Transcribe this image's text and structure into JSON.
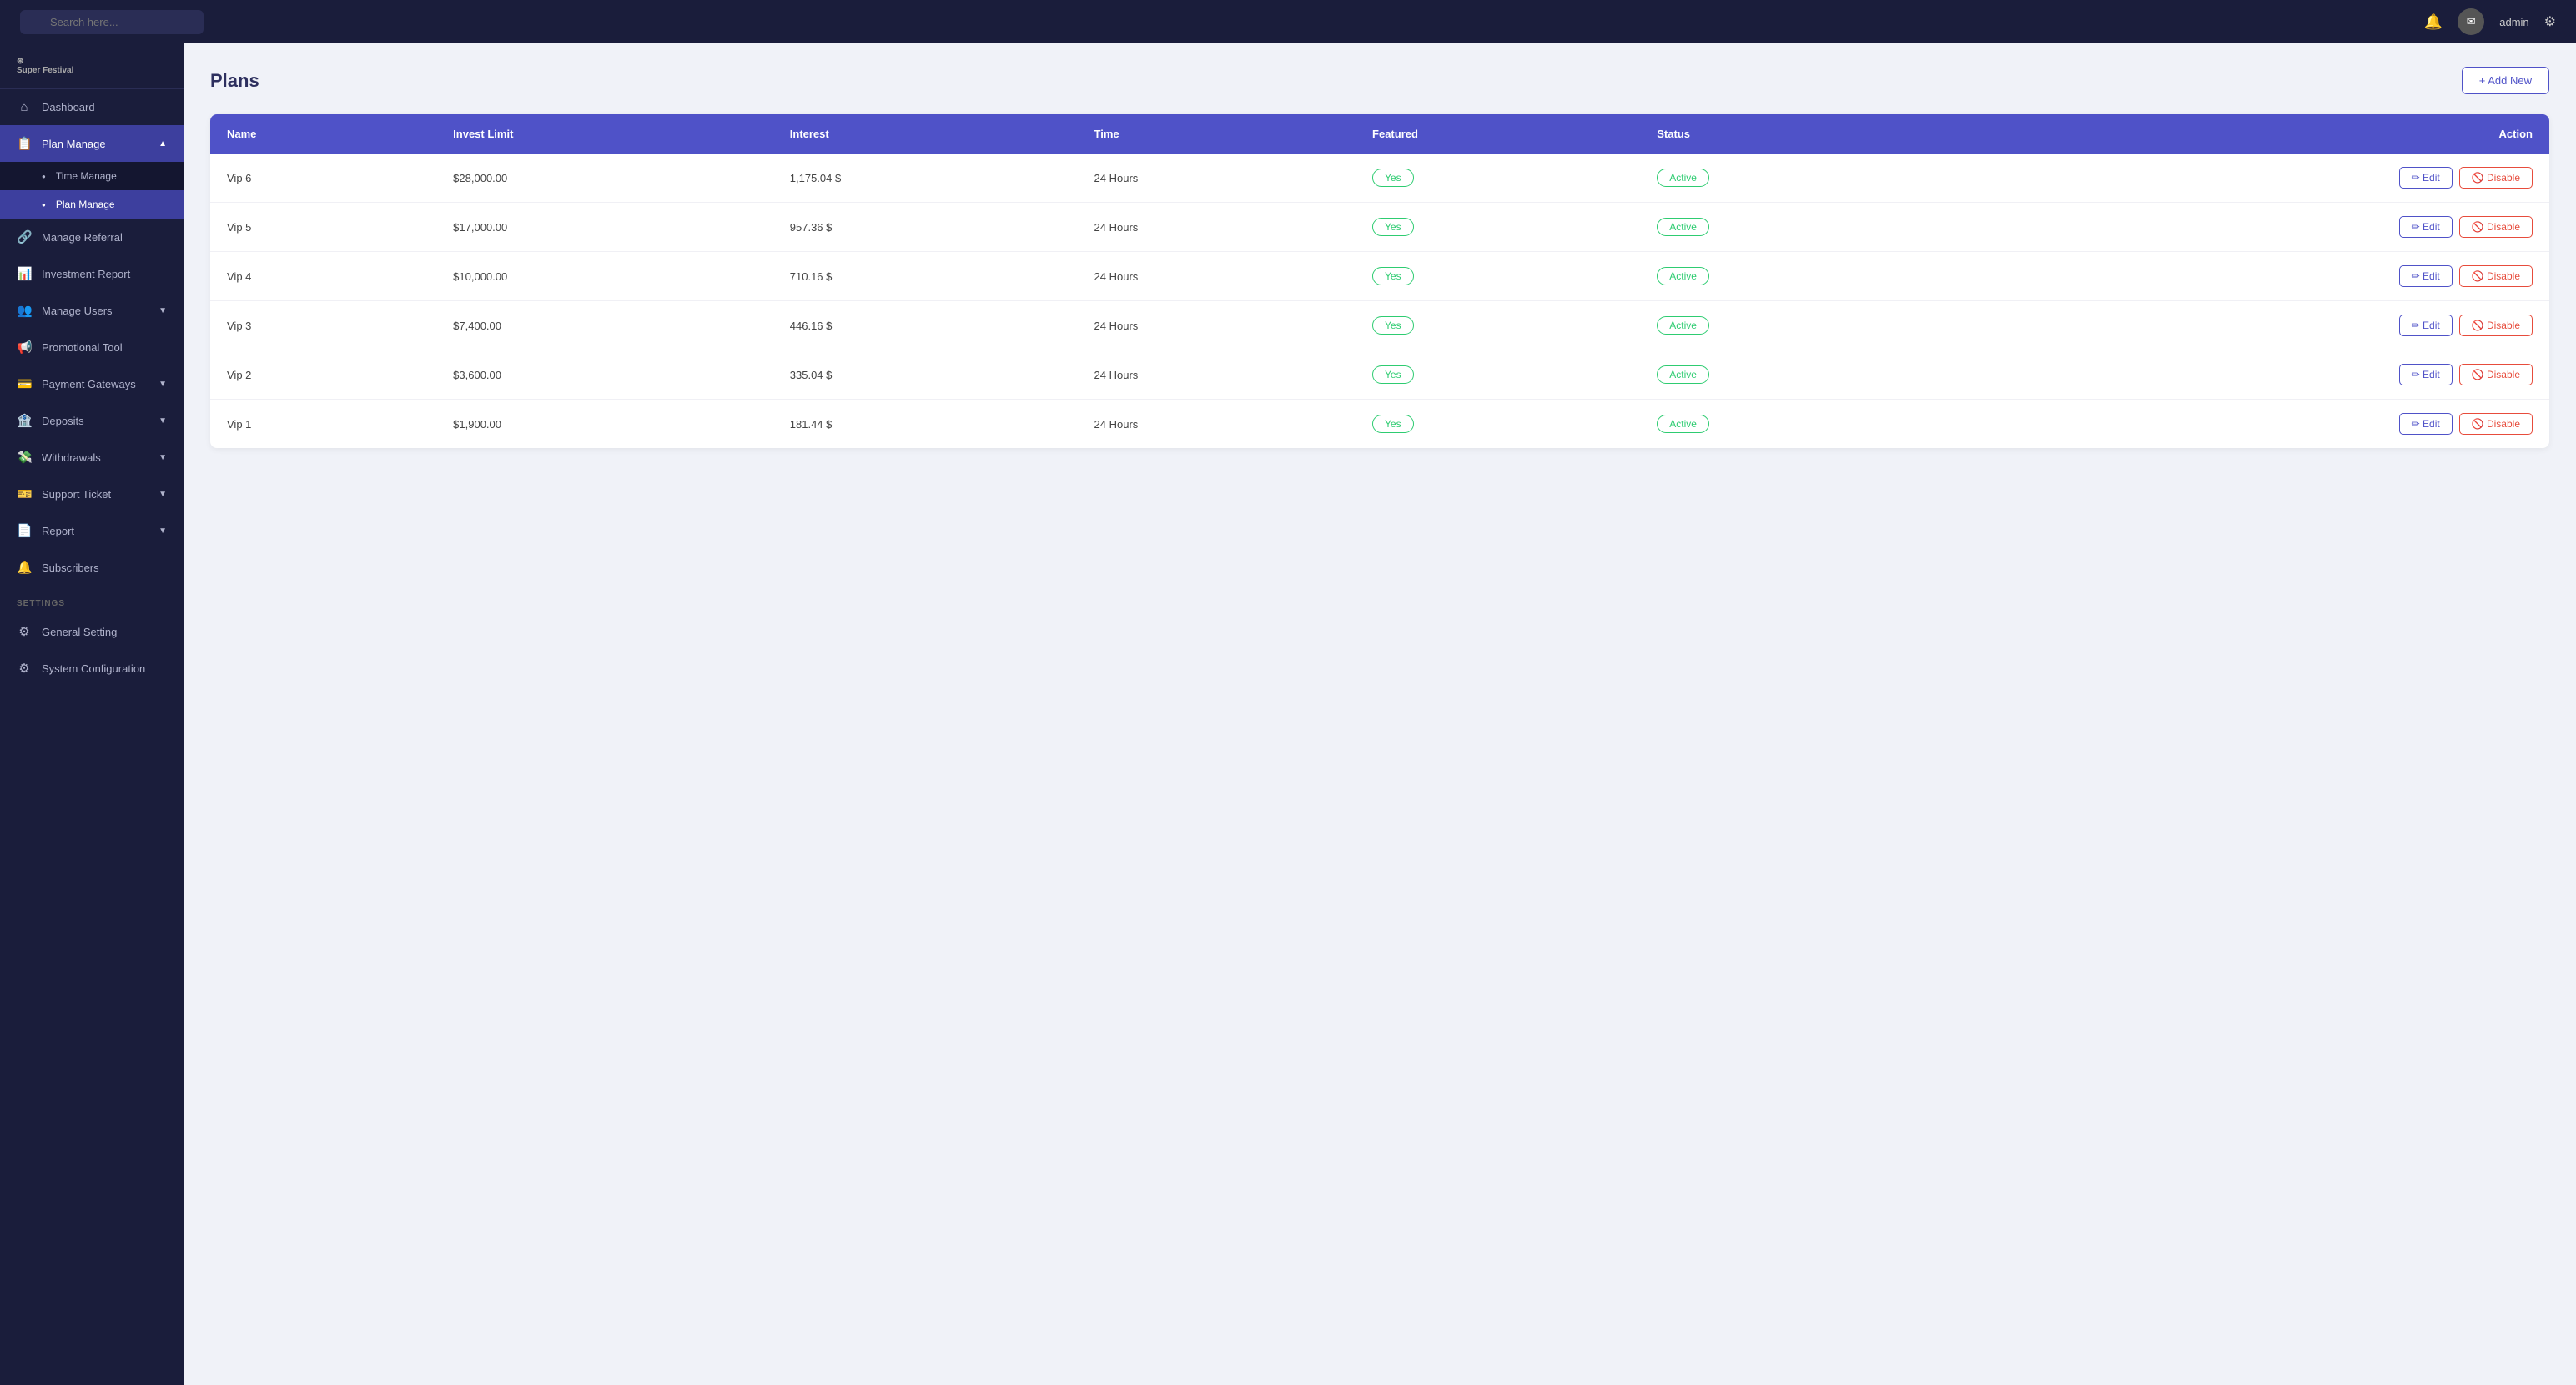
{
  "brand": {
    "prefix": "⊛",
    "name": "Super Festival"
  },
  "topbar": {
    "search_placeholder": "Search here...",
    "admin_name": "admin"
  },
  "sidebar": {
    "items": [
      {
        "id": "dashboard",
        "label": "Dashboard",
        "icon": "⌂",
        "active": false,
        "has_sub": false
      },
      {
        "id": "plan-manage",
        "label": "Plan Manage",
        "icon": "📋",
        "active": true,
        "has_sub": true,
        "expanded": true,
        "sub": [
          {
            "id": "time-manage",
            "label": "Time Manage",
            "active": false
          },
          {
            "id": "plan-manage-sub",
            "label": "Plan Manage",
            "active": true
          }
        ]
      },
      {
        "id": "manage-referral",
        "label": "Manage Referral",
        "icon": "🔗",
        "active": false,
        "has_sub": false
      },
      {
        "id": "investment-report",
        "label": "Investment Report",
        "icon": "📊",
        "active": false,
        "has_sub": false
      },
      {
        "id": "manage-users",
        "label": "Manage Users",
        "icon": "👥",
        "active": false,
        "has_sub": true
      },
      {
        "id": "promotional-tool",
        "label": "Promotional Tool",
        "icon": "📢",
        "active": false,
        "has_sub": false
      },
      {
        "id": "payment-gateways",
        "label": "Payment Gateways",
        "icon": "💳",
        "active": false,
        "has_sub": true
      },
      {
        "id": "deposits",
        "label": "Deposits",
        "icon": "🏦",
        "active": false,
        "has_sub": true
      },
      {
        "id": "withdrawals",
        "label": "Withdrawals",
        "icon": "💸",
        "active": false,
        "has_sub": true
      },
      {
        "id": "support-ticket",
        "label": "Support Ticket",
        "icon": "🎫",
        "active": false,
        "has_sub": true
      },
      {
        "id": "report",
        "label": "Report",
        "icon": "📄",
        "active": false,
        "has_sub": true
      },
      {
        "id": "subscribers",
        "label": "Subscribers",
        "icon": "🔔",
        "active": false,
        "has_sub": false
      }
    ],
    "settings_label": "SETTINGS",
    "settings_items": [
      {
        "id": "general-setting",
        "label": "General Setting",
        "icon": "⚙"
      },
      {
        "id": "system-configuration",
        "label": "System Configuration",
        "icon": "⚙"
      }
    ]
  },
  "page": {
    "title": "Plans",
    "add_button": "+ Add New"
  },
  "table": {
    "headers": [
      "Name",
      "Invest Limit",
      "Interest",
      "Time",
      "Featured",
      "Status",
      "Action"
    ],
    "rows": [
      {
        "name": "Vip 6",
        "invest_limit": "$28,000.00",
        "interest": "1,175.04 $",
        "time": "24 Hours",
        "featured": "Yes",
        "status": "Active"
      },
      {
        "name": "Vip 5",
        "invest_limit": "$17,000.00",
        "interest": "957.36 $",
        "time": "24 Hours",
        "featured": "Yes",
        "status": "Active"
      },
      {
        "name": "Vip 4",
        "invest_limit": "$10,000.00",
        "interest": "710.16 $",
        "time": "24 Hours",
        "featured": "Yes",
        "status": "Active"
      },
      {
        "name": "Vip 3",
        "invest_limit": "$7,400.00",
        "interest": "446.16 $",
        "time": "24 Hours",
        "featured": "Yes",
        "status": "Active"
      },
      {
        "name": "Vip 2",
        "invest_limit": "$3,600.00",
        "interest": "335.04 $",
        "time": "24 Hours",
        "featured": "Yes",
        "status": "Active"
      },
      {
        "name": "Vip 1",
        "invest_limit": "$1,900.00",
        "interest": "181.44 $",
        "time": "24 Hours",
        "featured": "Yes",
        "status": "Active"
      }
    ],
    "edit_label": "Edit",
    "disable_label": "Disable"
  }
}
